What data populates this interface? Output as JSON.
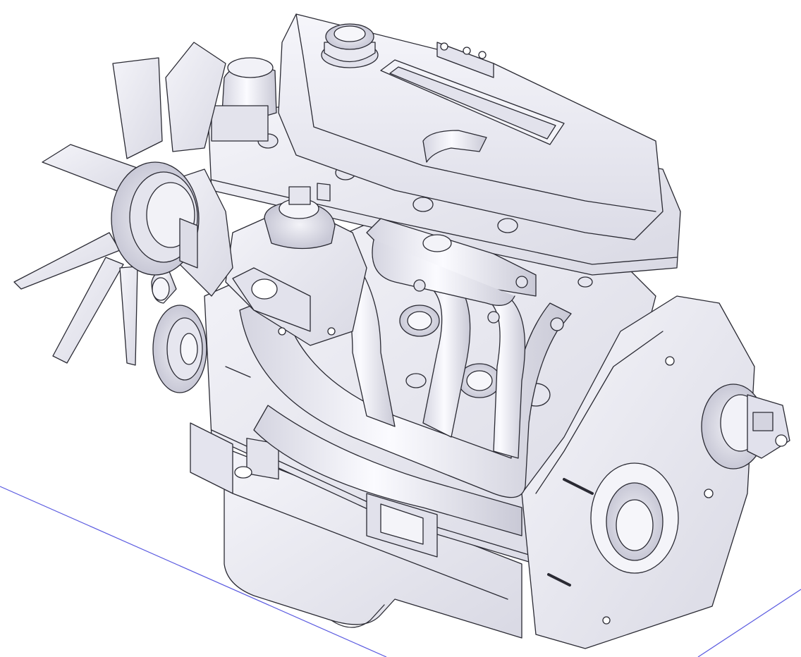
{
  "viewport": {
    "background_color": "#ffffff",
    "model_fill": "#ececf3",
    "model_shade": "#d7d7e2",
    "model_dark": "#b8b8c8",
    "edge_color": "#2a2a33",
    "ground_line_color": "#5a5ae0"
  },
  "model": {
    "subject": "engine-assembly",
    "render_style": "shaded-with-edges",
    "parts": [
      "cooling-fan",
      "water-pump-pulley",
      "cylinder-head",
      "valve-cover",
      "oil-filler-cap",
      "carburetor",
      "intake-manifold",
      "exhaust-manifold",
      "engine-block",
      "oil-pan",
      "bellhousing-plate",
      "starter-motor"
    ]
  }
}
